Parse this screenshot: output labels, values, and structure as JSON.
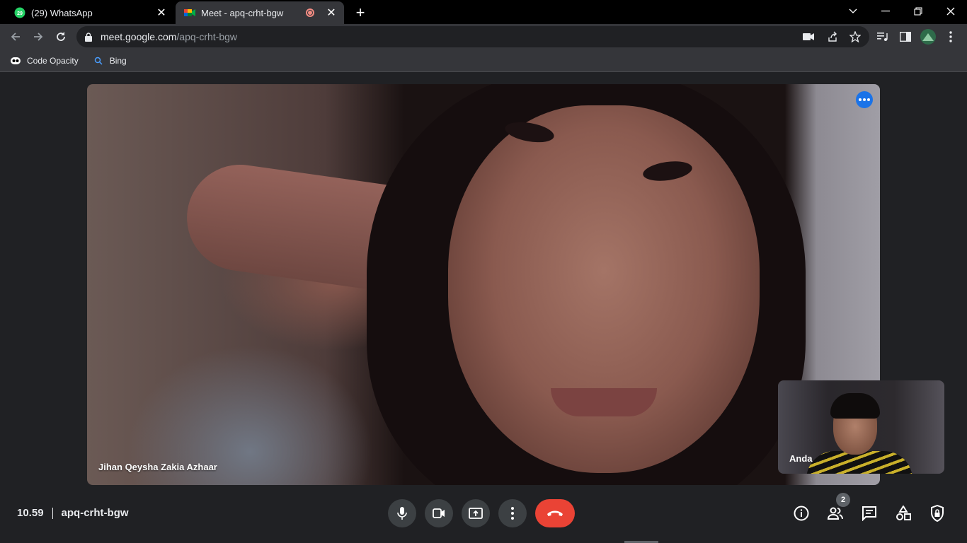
{
  "browser": {
    "tabs": [
      {
        "title": "(29) WhatsApp",
        "badge": "29",
        "active": false
      },
      {
        "title": "Meet - apq-crht-bgw",
        "active": true,
        "recording": true
      }
    ],
    "url_host": "meet.google.com",
    "url_path": "/apq-crht-bgw",
    "bookmarks": [
      {
        "label": "Code Opacity",
        "icon": "mask-icon"
      },
      {
        "label": "Bing",
        "icon": "search-icon"
      }
    ]
  },
  "meeting": {
    "main_participant": "Jihan Qeysha Zakia Azhaar",
    "self_label": "Anda",
    "time": "10.59",
    "code": "apq-crht-bgw",
    "participant_count": "2"
  },
  "colors": {
    "end_call": "#ea4335",
    "more_button": "#1a73e8",
    "background": "#202124"
  }
}
